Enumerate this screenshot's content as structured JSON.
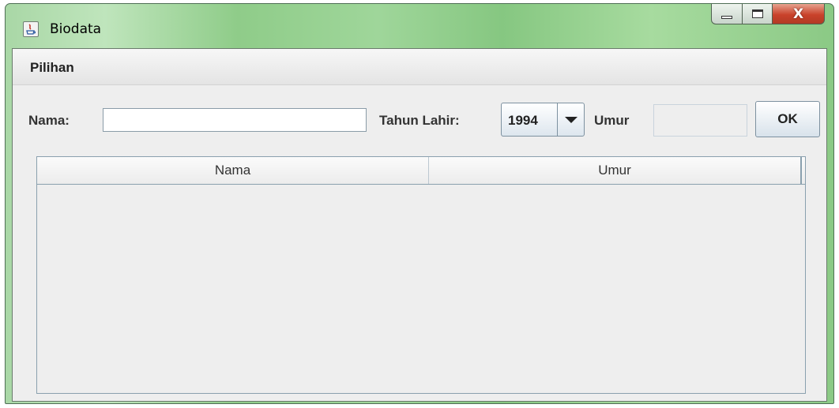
{
  "window": {
    "title": "Biodata",
    "buttons": {
      "minimize_icon": "minimize-icon",
      "maximize_icon": "maximize-icon",
      "close_label": "X"
    }
  },
  "menubar": {
    "items": [
      {
        "label": "Pilihan"
      }
    ]
  },
  "form": {
    "nama_label": "Nama:",
    "nama_value": "",
    "tahun_label": "Tahun Lahir:",
    "tahun_selected": "1994",
    "umur_label": "Umur",
    "umur_value": "",
    "ok_label": "OK"
  },
  "table": {
    "columns": [
      "Nama",
      "Umur"
    ],
    "rows": []
  },
  "colors": {
    "titlebar": "#9fd69a",
    "client_bg": "#eeeeee",
    "close_button": "#c9422b"
  }
}
